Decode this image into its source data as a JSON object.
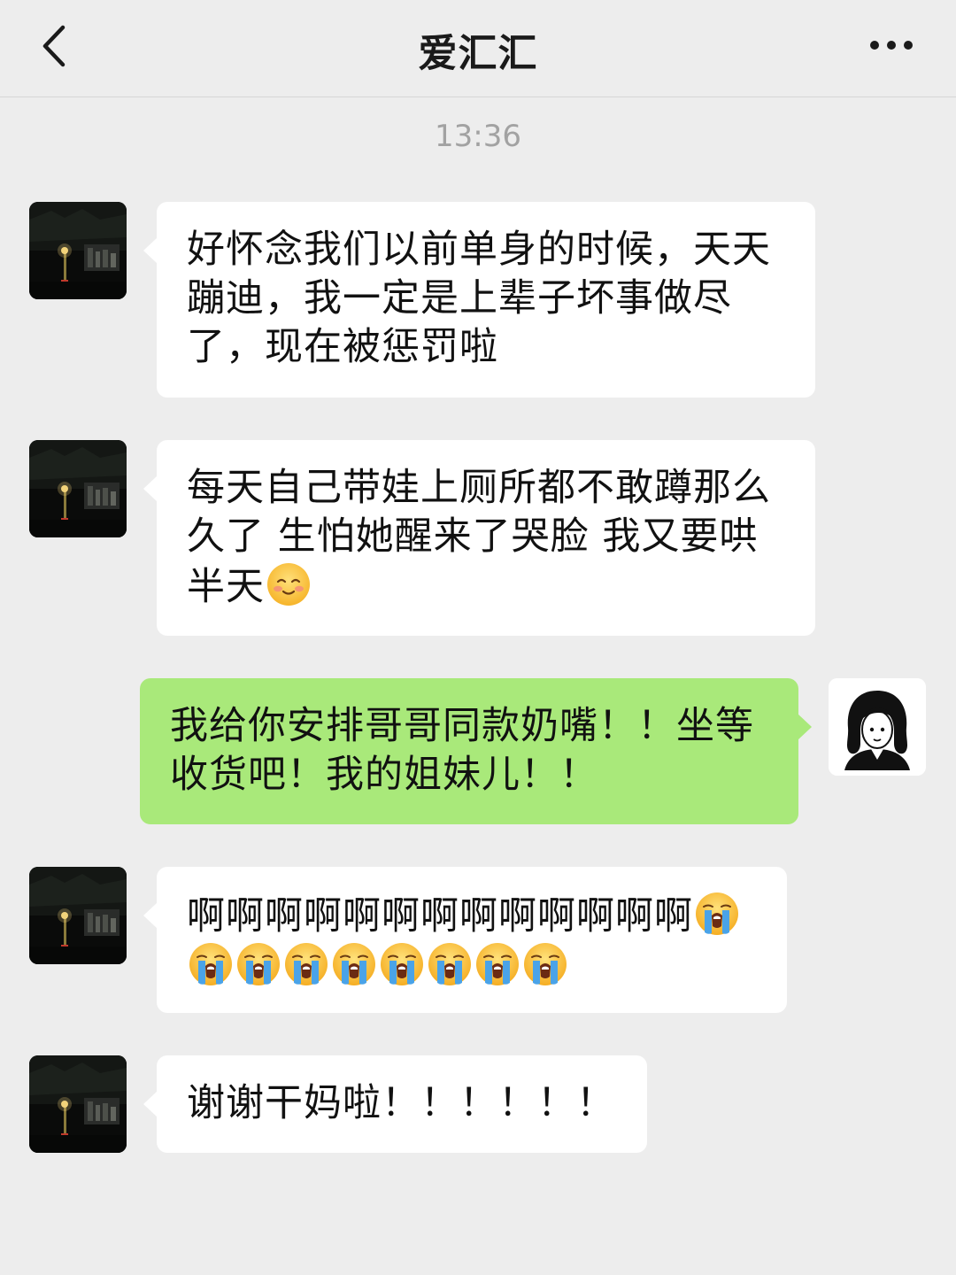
{
  "header": {
    "title": "爱汇汇",
    "back_icon": "chevron-left-icon",
    "more_icon": "more-dots-icon"
  },
  "timestamp": "13:36",
  "messages": [
    {
      "from": "other",
      "text": "好怀念我们以前单身的时候，天天蹦迪，我一定是上辈子坏事做尽了，现在被惩罚啦",
      "emojis": []
    },
    {
      "from": "other",
      "text": "每天自己带娃上厕所都不敢蹲那么久了 生怕她醒来了哭脸 我又要哄半天",
      "emojis": [
        "shy-smile-emoji"
      ]
    },
    {
      "from": "me",
      "text": "我给你安排哥哥同款奶嘴！！坐等收货吧！我的姐妹儿！！",
      "emojis": []
    },
    {
      "from": "other",
      "text": "啊啊啊啊啊啊啊啊啊啊啊啊啊",
      "emojis": [
        "loudly-crying-emoji",
        "loudly-crying-emoji",
        "loudly-crying-emoji",
        "loudly-crying-emoji",
        "loudly-crying-emoji",
        "loudly-crying-emoji",
        "loudly-crying-emoji",
        "loudly-crying-emoji",
        "loudly-crying-emoji"
      ]
    },
    {
      "from": "other",
      "text": "谢谢干妈啦！！！！！！",
      "emojis": []
    }
  ],
  "colors": {
    "background": "#ededed",
    "incoming_bubble": "#ffffff",
    "outgoing_bubble": "#a9e97a",
    "timestamp": "#a2a2a2"
  }
}
